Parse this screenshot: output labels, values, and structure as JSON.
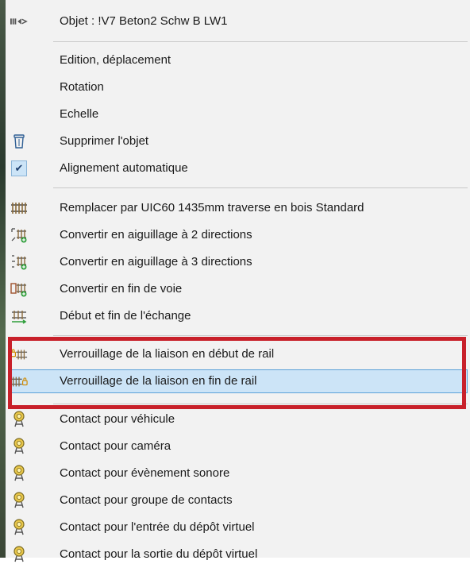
{
  "menu": {
    "header": {
      "label": "Objet : !V7 Beton2 Schw B LW1",
      "icon": "object-type-icon"
    },
    "items": [
      {
        "label": "Edition, déplacement",
        "icon": ""
      },
      {
        "label": "Rotation",
        "icon": ""
      },
      {
        "label": "Echelle",
        "icon": ""
      },
      {
        "label": "Supprimer l'objet",
        "icon": "trash-icon"
      },
      {
        "label": "Alignement automatique",
        "icon": "checkmark-icon",
        "checked": true
      },
      {
        "label": "Remplacer par UIC60 1435mm traverse en bois Standard",
        "icon": "track-replace-icon"
      },
      {
        "label": "Convertir en aiguillage à 2 directions",
        "icon": "switch-2way-icon"
      },
      {
        "label": "Convertir en aiguillage à 3 directions",
        "icon": "switch-3way-icon"
      },
      {
        "label": "Convertir en fin de voie",
        "icon": "track-end-icon"
      },
      {
        "label": "Début et fin de l'échange",
        "icon": "exchange-icon"
      },
      {
        "label": "Verrouillage de la liaison en début de rail",
        "icon": "lock-rail-start-icon"
      },
      {
        "label": "Verrouillage de la liaison en fin de rail",
        "icon": "lock-rail-end-icon",
        "hovered": true
      },
      {
        "label": "Contact pour véhicule",
        "icon": "contact-icon"
      },
      {
        "label": "Contact pour caméra",
        "icon": "contact-icon"
      },
      {
        "label": "Contact pour évènement sonore",
        "icon": "contact-icon"
      },
      {
        "label": "Contact pour groupe de contacts",
        "icon": "contact-icon"
      },
      {
        "label": "Contact pour l'entrée du dépôt virtuel",
        "icon": "contact-icon"
      },
      {
        "label": "Contact pour la sortie du dépôt virtuel",
        "icon": "contact-icon"
      }
    ]
  },
  "colors": {
    "menu_background": "#f2f2f2",
    "hover_background": "#cce4f7",
    "hover_border": "#5aa0d8",
    "highlight_frame": "#c8202a",
    "separator": "#c9c9c9"
  }
}
